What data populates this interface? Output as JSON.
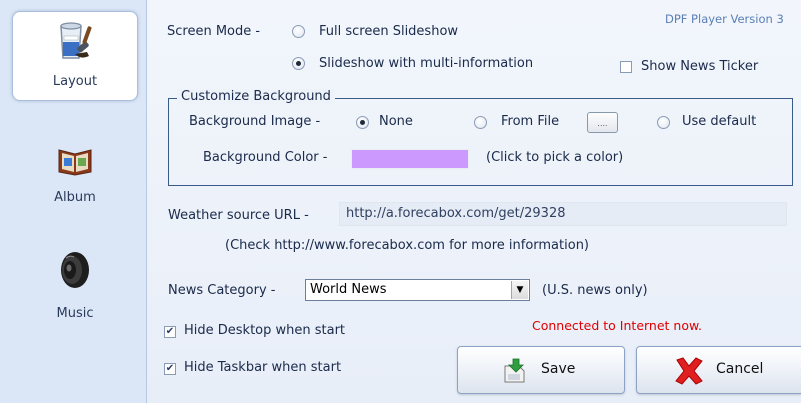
{
  "sidebar": {
    "items": [
      {
        "label": "Layout",
        "icon": "paint-bucket-icon",
        "active": true
      },
      {
        "label": "Album",
        "icon": "photo-album-icon",
        "active": false
      },
      {
        "label": "Music",
        "icon": "speaker-icon",
        "active": false
      }
    ]
  },
  "header": {
    "title": "DPF Player Version 3"
  },
  "screen_mode": {
    "label": "Screen Mode -",
    "options": [
      "Full screen Slideshow",
      "Slideshow with multi-information"
    ],
    "selected": 1
  },
  "news_ticker": {
    "label": "Show News Ticker",
    "checked": false
  },
  "customize_background": {
    "title": "Customize Background",
    "image_label": "Background Image -",
    "image_options": [
      "None",
      "From File",
      "Use default"
    ],
    "image_selected": 0,
    "browse_label": "....",
    "color_label": "Background Color -",
    "color_value": "#cc99ff",
    "color_hint": "(Click to pick a color)"
  },
  "weather": {
    "label": "Weather source URL -",
    "url": "http://a.forecabox.com/get/29328",
    "hint": "(Check http://www.forecabox.com for more information)"
  },
  "news": {
    "label": "News Category -",
    "selected": "World News",
    "hint": "(U.S. news only)"
  },
  "options": {
    "hide_desktop": {
      "label": "Hide Desktop  when start",
      "checked": true
    },
    "hide_taskbar": {
      "label": "Hide Taskbar when start",
      "checked": true
    }
  },
  "status": {
    "text": "Connected to Internet now.",
    "color": "#e00000"
  },
  "buttons": {
    "save": "Save",
    "cancel": "Cancel"
  }
}
